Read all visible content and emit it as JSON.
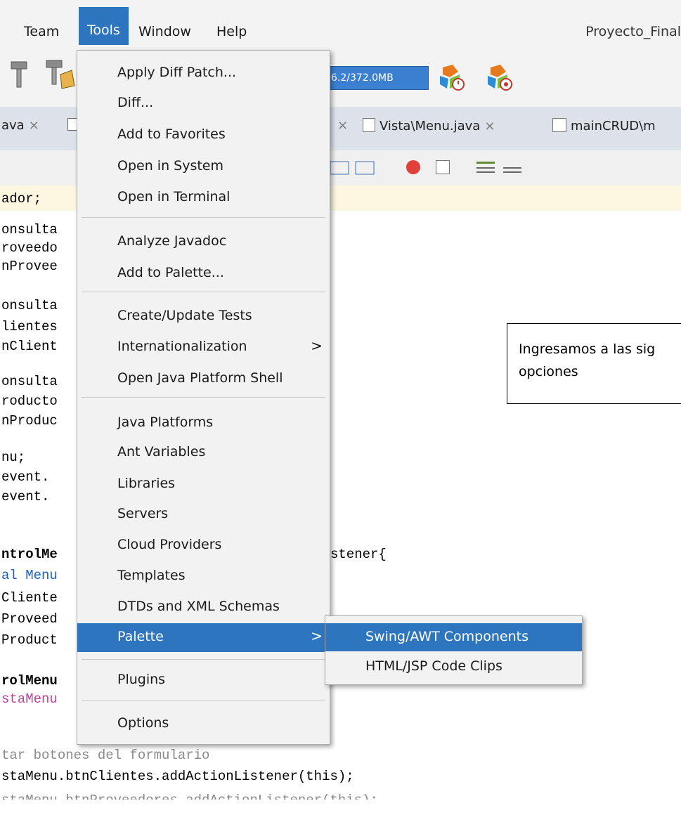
{
  "menubar": {
    "items": [
      "Team",
      "Tools",
      "Window",
      "Help"
    ],
    "active": "Tools",
    "project_title": "Proyecto_Final"
  },
  "toolbar": {
    "memory": "6.2/372.0MB",
    "icons": [
      "hammer-icon",
      "clean-build-icon",
      "gc-icon",
      "profile-icon"
    ]
  },
  "tabs": [
    {
      "label": "ava",
      "close": "×"
    },
    {
      "label": "",
      "close": "×"
    },
    {
      "label": "Vista\\Menu.java",
      "close": "×"
    },
    {
      "label": "mainCRUD\\m",
      "close": ""
    }
  ],
  "tools_menu": {
    "groups": [
      [
        "Apply Diff Patch...",
        "Diff...",
        "Add to Favorites",
        "Open in System",
        "Open in Terminal"
      ],
      [
        "Analyze Javadoc",
        "Add to Palette..."
      ],
      [
        "Create/Update Tests",
        "Internationalization",
        "Open Java Platform Shell"
      ],
      [
        "Java Platforms",
        "Ant Variables",
        "Libraries",
        "Servers",
        "Cloud Providers",
        "Templates",
        "DTDs and XML Schemas",
        "Palette"
      ],
      [
        "Plugins"
      ],
      [
        "Options"
      ]
    ],
    "selected": "Palette",
    "submenu_items": [
      "Internationalization",
      "Palette"
    ]
  },
  "palette_submenu": {
    "items": [
      "Swing/AWT Components",
      "HTML/JSP Code Clips"
    ],
    "selected": "Swing/AWT Components"
  },
  "callout": {
    "text": "Ingresamos a las sig\nopciones"
  },
  "code": {
    "lines": [
      "ador;",
      "onsulta",
      "roveedo",
      "nProvee",
      "onsulta",
      "lientes",
      "nClient",
      "onsulta",
      "roducto",
      "nProduc",
      "nu;",
      "event.",
      "event.",
      "",
      "ntrolMe",
      "al Menu",
      "Cliente",
      "Proveed",
      "Product",
      "",
      "rolMenu",
      "staMenu",
      "",
      "tar botones del formulario",
      "staMenu.btnClientes.addActionListener(this);"
    ],
    "fragment_right": "stener{"
  },
  "colors": {
    "accent": "#2d75bf",
    "menu_bg": "#f2f2f2",
    "keyword": "#1a5fc7",
    "field": "#c0429a",
    "comment": "#8a8a8a"
  }
}
